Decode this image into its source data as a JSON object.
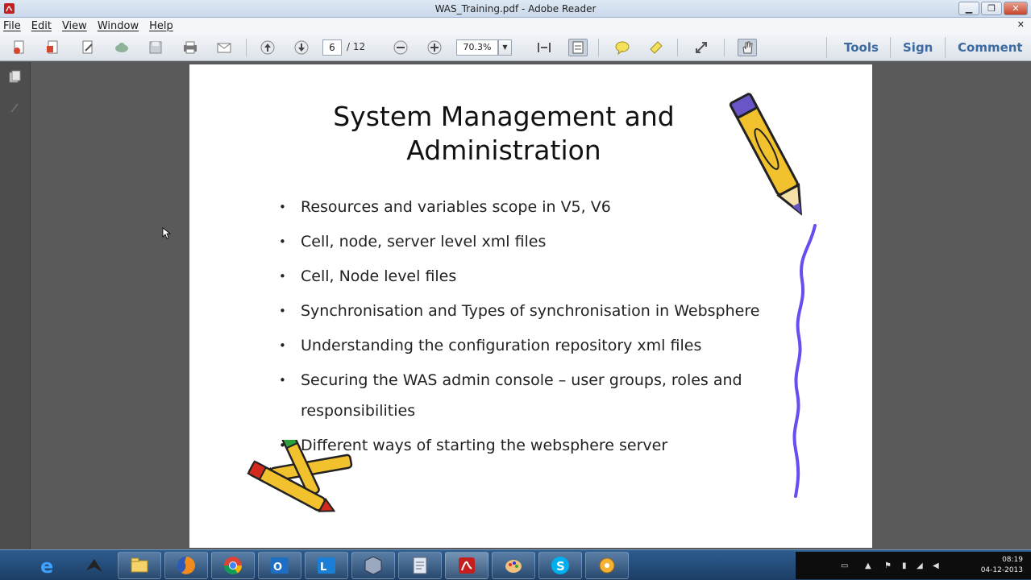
{
  "window": {
    "title": "WAS_Training.pdf - Adobe Reader"
  },
  "menu": {
    "items": [
      "File",
      "Edit",
      "View",
      "Window",
      "Help"
    ]
  },
  "toolbar": {
    "page_current": "6",
    "page_total": "/ 12",
    "zoom": "70.3%",
    "right_tabs": [
      "Tools",
      "Sign",
      "Comment"
    ]
  },
  "slide": {
    "title_line1": "System Management and",
    "title_line2": "Administration",
    "bullets": [
      "Resources and variables scope in V5, V6",
      "Cell, node, server level xml files",
      "Cell, Node level files",
      "Synchronisation and Types of synchronisation in Websphere",
      "Understanding the configuration repository xml files",
      "Securing the WAS admin console – user groups, roles and",
      "responsibilities",
      "Different ways of starting the websphere server"
    ]
  },
  "taskbar": {
    "apps": [
      "internet-explorer",
      "unknown-app",
      "file-explorer",
      "firefox",
      "chrome",
      "outlook",
      "lync",
      "virtualbox",
      "notepad",
      "adobe-reader",
      "paint",
      "skype",
      "settings"
    ],
    "clock_time": "08:19",
    "clock_date": "04-12-2013"
  },
  "colors": {
    "accent_tabs": "#3d6aa0",
    "taskbar": "#2d5c8f",
    "background": "#5a5a5a"
  }
}
